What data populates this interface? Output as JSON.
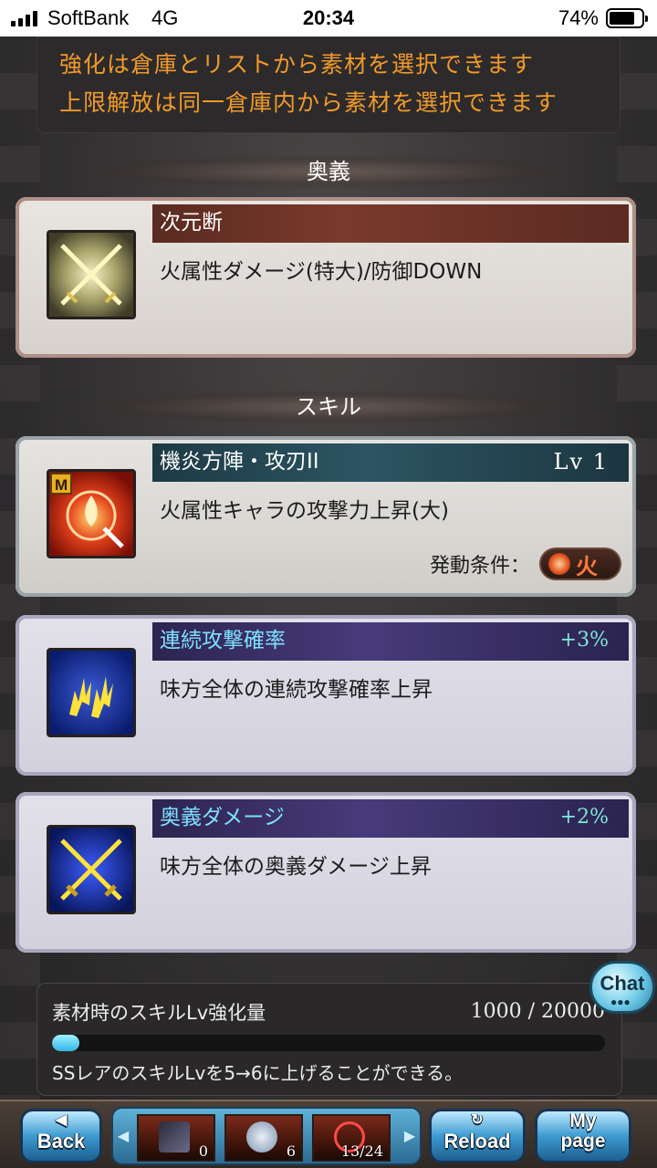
{
  "status_bar": {
    "carrier": "SoftBank",
    "network": "4G",
    "time": "20:34",
    "battery": "74%"
  },
  "info": {
    "line1": "強化は倉庫とリストから素材を選択できます",
    "line2": "上限解放は同一倉庫内から素材を選択できます"
  },
  "sections": {
    "ougi_title": "奥義",
    "skill_title": "スキル"
  },
  "ougi_card": {
    "name": "次元断",
    "description": "火属性ダメージ(特大)/防御DOWN",
    "icon": "crossed-swords-icon"
  },
  "skill_card": {
    "name": "機炎方陣・攻刃II",
    "level": "Lv 1",
    "description": "火属性キャラの攻撃力上昇(大)",
    "activation_label": "発動条件：",
    "element": "火",
    "icon": "fire-sword-skill-icon",
    "badge": "M"
  },
  "bonus_cards": [
    {
      "name": "連続攻撃確率",
      "value": "+3%",
      "description": "味方全体の連続攻撃確率上昇",
      "icon": "triple-strike-icon"
    },
    {
      "name": "奥義ダメージ",
      "value": "+2%",
      "description": "味方全体の奥義ダメージ上昇",
      "icon": "crossed-swords-blue-icon"
    }
  ],
  "material_panel": {
    "label": "素材時のスキルLv強化量",
    "value": "1000 / 20000",
    "progress": 0.05,
    "note": "SSレアのスキルLvを5→6に上げることができる。"
  },
  "chat_button": {
    "label": "Chat"
  },
  "bottom_nav": {
    "back_label": "Back",
    "reload_label": "Reload",
    "mypage_label_1": "My",
    "mypage_label_2": "page",
    "slots": [
      {
        "count": "0"
      },
      {
        "count": "6"
      },
      {
        "count": "13/24"
      }
    ]
  },
  "colors": {
    "info_text": "#f09a2a",
    "bonus_name": "#7fe0ff",
    "bonus_value": "#7fe8d8",
    "progress_fill": "#34b5e8"
  }
}
